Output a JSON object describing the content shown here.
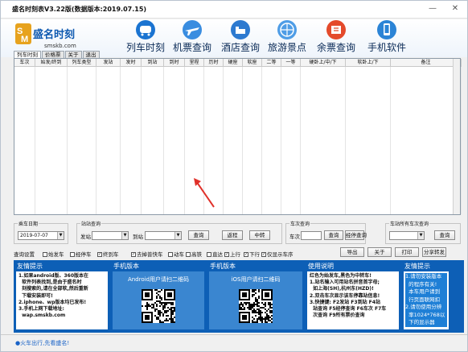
{
  "window": {
    "title": "盛名时刻表V3.22版(数据版本:2019.07.15)",
    "minimize": "—",
    "close": "✕"
  },
  "brand": {
    "logo_text": "盛名时刻",
    "logo_url": "smskb.com"
  },
  "features": [
    {
      "label": "列车时刻",
      "icon": "train-icon",
      "color": "#1b74d1"
    },
    {
      "label": "机票查询",
      "icon": "airplane-icon",
      "color": "#3a8de0"
    },
    {
      "label": "酒店查询",
      "icon": "hotel-icon",
      "color": "#2d7ad0"
    },
    {
      "label": "旅游景点",
      "icon": "globe-icon",
      "color": "#4f9de6"
    },
    {
      "label": "余票查询",
      "icon": "ticket-icon",
      "color": "#e44a2b"
    },
    {
      "label": "手机软件",
      "icon": "phone-icon",
      "color": "#2b84d6"
    }
  ],
  "tabs": [
    "列车时刻",
    "价格票",
    "关于",
    "退出"
  ],
  "table": {
    "columns": [
      "车次",
      "始发/终到",
      "列车类型",
      "发站",
      "发时",
      "到站",
      "到时",
      "里程",
      "历时",
      "硬座",
      "软座",
      "二等",
      "一等",
      "硬卧上/中/下",
      "软卧上/下",
      "备注"
    ]
  },
  "query": {
    "date_legend": "乘车日期",
    "date_value": "2019-07-07",
    "station_legend": "站站查询",
    "from_label": "发站",
    "to_label": "到站",
    "btn_query": "查询",
    "btn_return": "返程",
    "btn_transfer": "中转",
    "train_legend": "车次查询",
    "train_label": "车次",
    "btn_train_query": "查询",
    "btn_stops": "经停查询",
    "station_trains_legend": "车站所有车次查询",
    "btn_station_query": "查询"
  },
  "filters": {
    "label": "查询设置",
    "items": [
      "始发车",
      "经停车",
      "终到车",
      "去掉普快车",
      "动车",
      "高铁",
      "直达",
      "上行",
      "下行",
      "仅显示车序"
    ],
    "checked": [
      false,
      false,
      true,
      true,
      false,
      false,
      false,
      true,
      true,
      true
    ],
    "btn_export": "导出",
    "btn_about": "关于",
    "btn_print": "打印",
    "btn_share": "分享转发"
  },
  "panels": {
    "p1_title": "友情提示",
    "p1_text": "1.如果android版、360版本在\n  软件列表找到,是由于盛名时\n  刻搜索的,请在全部软,然后重新\n  下载安装即可!\n2.iphone、wp版本均已发布!\n3.手机上网下载地址:\n  wap.smskb.com",
    "p2_title": "手机版本",
    "p2_qr": "Android用户请扫二维码",
    "p3_title": "手机版本",
    "p3_qr": "iOS用户请扫二维码",
    "p4_title": "使用说明",
    "p4_text": "红色为始发车,黑色为中转车!\n1.站名输入可用站名拼音首字母;\n  如上海(SH),杭州东(HZD)!\n2.双击车次显示该车停靠站信息!\n3.快捷键: F2发站 F3到站 F4站\n  站查询 F5经停查询 F6车次 F7车\n  次查询 F9所有票价查询",
    "p5_title": "友情提示",
    "p5_text": "1.请勿安装版本\n  的程序有关!\n  本车用户请到\n  行页面联网扣\n2.请勿使用分辨\n  率1024*768以\n  下的显示器"
  },
  "status": "●火车出行,先看盛名!"
}
